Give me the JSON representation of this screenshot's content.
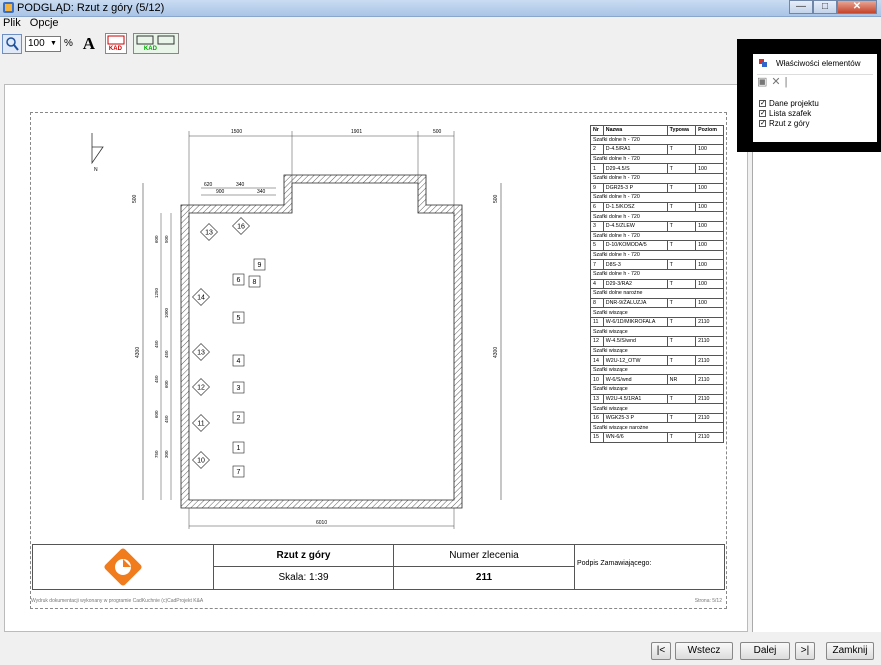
{
  "window": {
    "title": "PODGLĄD: Rzut z góry (5/12)",
    "minimize": "—",
    "maximize": "□",
    "close": "✕"
  },
  "menu": {
    "items": [
      "Plik",
      "Opcje"
    ]
  },
  "toolbar": {
    "zoom_value": "100",
    "zoom_unit": "%",
    "font_label": "A",
    "kaod_label": "KAD"
  },
  "drawing": {
    "dims": {
      "top_1": "1500",
      "top_2": "1901",
      "top_3": "500",
      "sub_1": "620",
      "sub_2": "340",
      "sub_3": "900",
      "sub_4": "340",
      "left_top": "500",
      "right_top": "500",
      "left_full": "4300",
      "right_full": "4300",
      "bottom": "6010",
      "north": "N",
      "v1": "600",
      "v2": "1250",
      "v3": "1000",
      "v4": "450",
      "v5": "450",
      "v6": "600",
      "v7": "750",
      "s1": "500",
      "s2": "600",
      "s3": "300",
      "s4": "450",
      "s5": "600",
      "s6": "450",
      "s7": "800",
      "s8": "300"
    },
    "diamond_labels": [
      "13",
      "16",
      "14",
      "13",
      "12",
      "11",
      "10"
    ],
    "box_labels": [
      "9",
      "6",
      "8",
      "5",
      "4",
      "3",
      "2",
      "1",
      "7"
    ]
  },
  "parts_table": {
    "headers": [
      "Nr",
      "Nazwa",
      "Typowa",
      "Poziom"
    ],
    "rows": [
      {
        "cat": "Szafki dolne h - 720"
      },
      {
        "nr": "2",
        "name": "D-4.5/RA1",
        "typ": "T",
        "poz": "100"
      },
      {
        "cat": "Szafki dolne h - 720"
      },
      {
        "nr": "1",
        "name": "D29-4.5/S",
        "typ": "T",
        "poz": "100"
      },
      {
        "cat": "Szafki dolne h - 720"
      },
      {
        "nr": "9",
        "name": "DGR25-3 P",
        "typ": "T",
        "poz": "100"
      },
      {
        "cat": "Szafki dolne h - 720"
      },
      {
        "nr": "6",
        "name": "D-1.5/KOSZ",
        "typ": "T",
        "poz": "100"
      },
      {
        "cat": "Szafki dolne h - 720"
      },
      {
        "nr": "3",
        "name": "D-4.5/ZLEW",
        "typ": "T",
        "poz": "100"
      },
      {
        "cat": "Szafki dolne h - 720"
      },
      {
        "nr": "5",
        "name": "D-10/KOMODA/5",
        "typ": "T",
        "poz": "100"
      },
      {
        "cat": "Szafki dolne h - 720"
      },
      {
        "nr": "7",
        "name": "D8S-3",
        "typ": "T",
        "poz": "100"
      },
      {
        "cat": "Szafki dolne h - 720"
      },
      {
        "nr": "4",
        "name": "D29-3/RA2",
        "typ": "T",
        "poz": "100"
      },
      {
        "cat": "Szafki dolne narożne"
      },
      {
        "nr": "8",
        "name": "DNR-9/ŻALUZJA",
        "typ": "T",
        "poz": "100"
      },
      {
        "cat": "Szafki wiszące"
      },
      {
        "nr": "11",
        "name": "W-6/1D/MIKROFALA",
        "typ": "T",
        "poz": "2110"
      },
      {
        "cat": "Szafki wiszące"
      },
      {
        "nr": "12",
        "name": "W-4.5/S/wnd",
        "typ": "T",
        "poz": "2110"
      },
      {
        "cat": "Szafki wiszące"
      },
      {
        "nr": "14",
        "name": "W2U-12_OTW",
        "typ": "T",
        "poz": "2110"
      },
      {
        "cat": "Szafki wiszące"
      },
      {
        "nr": "10",
        "name": "W-6/S/wnd",
        "typ": "NR",
        "poz": "2110"
      },
      {
        "cat": "Szafki wiszące"
      },
      {
        "nr": "13",
        "name": "W2U-4.5/1RA1",
        "typ": "T",
        "poz": "2110"
      },
      {
        "cat": "Szafki wiszące"
      },
      {
        "nr": "16",
        "name": "WGK25-3 P",
        "typ": "T",
        "poz": "2110"
      },
      {
        "cat": "Szafki wiszące narożne"
      },
      {
        "nr": "15",
        "name": "WN-6/6",
        "typ": "T",
        "poz": "2110"
      }
    ]
  },
  "title_block": {
    "drawing_name": "Rzut z góry",
    "scale": "Skala: 1:39",
    "order_label": "Numer zlecenia",
    "order_number": "211",
    "signature": "Podpis Zamawiającego:"
  },
  "footer": {
    "left": "Wydruk dokumentacji wykonany w programie CadKuchnie (c)CadProjekt K&A",
    "right": "Strona: 5/12"
  },
  "properties_panel": {
    "title": "Właściwości elementów",
    "items": [
      {
        "label": "Dane projektu",
        "checked": true
      },
      {
        "label": "Lista szafek",
        "checked": true
      },
      {
        "label": "Rzut z góry",
        "checked": true
      }
    ]
  },
  "nav_buttons": {
    "first": "|<",
    "back": "Wstecz",
    "next": "Dalej",
    "last": ">|",
    "close": "Zamknij"
  },
  "colors": {
    "logo": "#f07c1e",
    "titlebar": "#b9d1ee"
  }
}
